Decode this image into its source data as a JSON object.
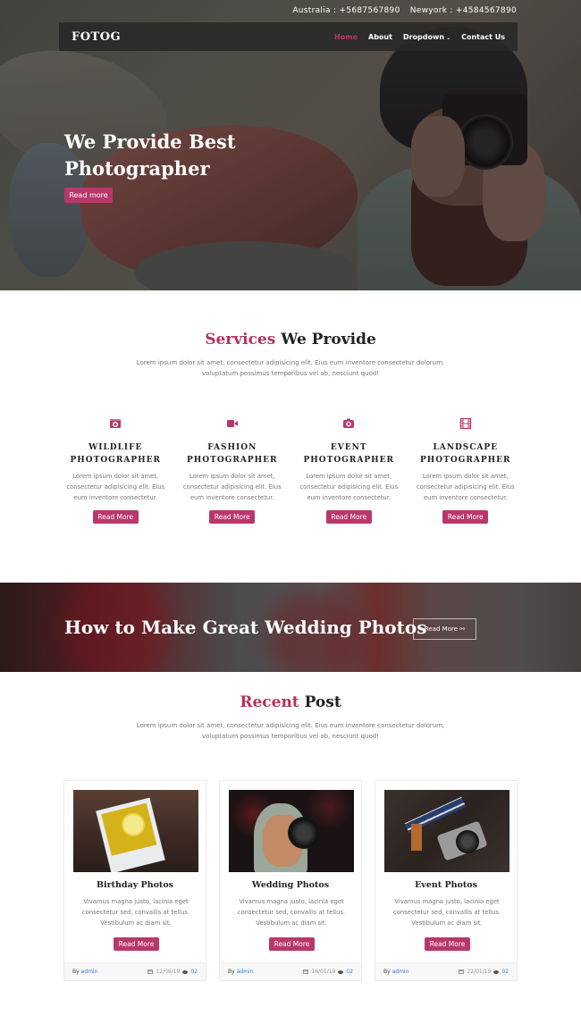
{
  "colors": {
    "accent": "#b9376b",
    "heading": "#222222",
    "muted_text": "#777777",
    "link": "#3a7bd5",
    "navbar_bg": "#282828"
  },
  "topbar": {
    "contacts": [
      {
        "label": "Australia : +5687567890"
      },
      {
        "label": "Newyork : +4584567890"
      }
    ]
  },
  "navbar": {
    "brand": "FOTOG",
    "items": [
      {
        "label": "Home",
        "active": true
      },
      {
        "label": "About",
        "active": false
      },
      {
        "label": "Dropdown",
        "active": false,
        "icon": "chevron-down-icon"
      },
      {
        "label": "Contact Us",
        "active": false
      }
    ]
  },
  "hero": {
    "title_line1": "We Provide Best",
    "title_line2": "Photographer",
    "button": "Read more"
  },
  "services_section": {
    "title_accent": "Services",
    "title_rest": "We Provide",
    "description": "Lorem ipsum dolor sit amet, consectetur adipisicing elit. Eius eum inventore consectetur dolorum, voluptatum possimus temporibus vel ab, nesciunt quod!",
    "items": [
      {
        "icon": "photo-camera-icon",
        "title_line1": "WILDLIFE",
        "title_line2": "PHOTOGRAPHER",
        "description": "Lorem ipsum dolor sit amet, consectetur adipisicing elit. Eius eum inventore consectetur.",
        "button": "Read More"
      },
      {
        "icon": "video-camera-icon",
        "title_line1": "FASHION",
        "title_line2": "PHOTOGRAPHER",
        "description": "Lorem ipsum dolor sit amet, consectetur adipisicing elit. Eius eum inventore consectetur.",
        "button": "Read More"
      },
      {
        "icon": "camera-icon",
        "title_line1": "EVENT",
        "title_line2": "PHOTOGRAPHER",
        "description": "Lorem ipsum dolor sit amet, consectetur adipisicing elit. Eius eum inventore consectetur.",
        "button": "Read More"
      },
      {
        "icon": "film-icon",
        "title_line1": "LANDSCAPE",
        "title_line2": "PHOTOGRAPHER",
        "description": "Lorem ipsum dolor sit amet, consectetur adipisicing elit. Eius eum inventore consectetur.",
        "button": "Read More"
      }
    ]
  },
  "banner": {
    "title": "How to Make Great Wedding Photos",
    "button": "Read More",
    "button_icon": "link-icon"
  },
  "posts_section": {
    "title_accent": "Recent",
    "title_rest": "Post",
    "description": "Lorem ipsum dolor sit amet, consectetur adipisicing elit. Eius eum inventore consectetur dolorum, voluptatum possimus temporibus vel ab, nesciunt quod!",
    "posts": [
      {
        "title": "Birthday Photos",
        "description": "Vivamus magna justo, lacinia eget consectetur sed, convallis at tellus. Vestibulum ac diam sit.",
        "button": "Read More",
        "by_label": "By",
        "author": "admin",
        "date": "12/09/19",
        "comments": "02"
      },
      {
        "title": "Wedding Photos",
        "description": "Vivamus magna justo, lacinia eget consectetur sed, convallis at tellus. Vestibulum ac diam sit.",
        "button": "Read More",
        "by_label": "By",
        "author": "admin",
        "date": "16/01/19",
        "comments": "02"
      },
      {
        "title": "Event Photos",
        "description": "Vivamus magna justo, lacinia eget consectetur sed, convallis at tellus. Vestibulum ac diam sit.",
        "button": "Read More",
        "by_label": "By",
        "author": "admin",
        "date": "22/01/19",
        "comments": "02"
      }
    ]
  }
}
